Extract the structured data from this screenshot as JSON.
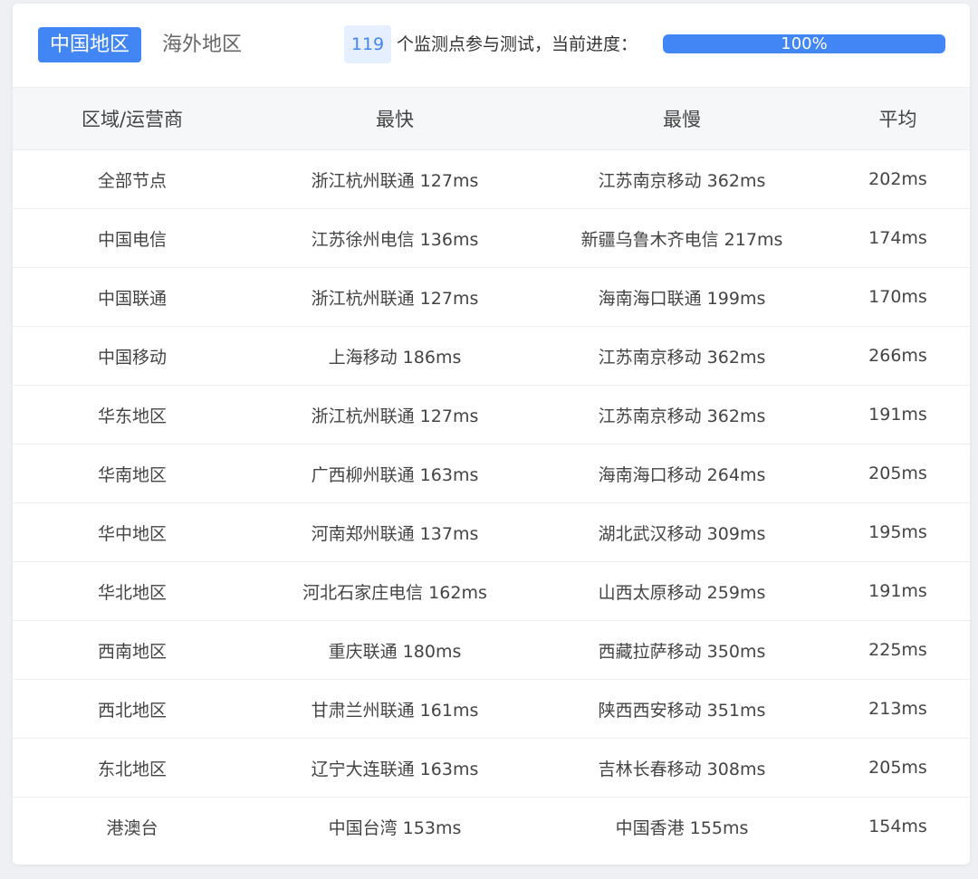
{
  "tabs": {
    "active": "中国地区",
    "inactive": "海外地区"
  },
  "progress": {
    "count": "119",
    "text": "个监测点参与测试，当前进度：",
    "percent_label": "100%",
    "percent_value": 100
  },
  "colors": {
    "accent": "#4285f4",
    "badge_bg": "#e6efff",
    "header_bg": "#f6f7f9"
  },
  "table": {
    "headers": [
      "区域/运营商",
      "最快",
      "最慢",
      "平均"
    ],
    "rows": [
      [
        "全部节点",
        "浙江杭州联通 127ms",
        "江苏南京移动 362ms",
        "202ms"
      ],
      [
        "中国电信",
        "江苏徐州电信 136ms",
        "新疆乌鲁木齐电信 217ms",
        "174ms"
      ],
      [
        "中国联通",
        "浙江杭州联通 127ms",
        "海南海口联通 199ms",
        "170ms"
      ],
      [
        "中国移动",
        "上海移动 186ms",
        "江苏南京移动 362ms",
        "266ms"
      ],
      [
        "华东地区",
        "浙江杭州联通 127ms",
        "江苏南京移动 362ms",
        "191ms"
      ],
      [
        "华南地区",
        "广西柳州联通 163ms",
        "海南海口移动 264ms",
        "205ms"
      ],
      [
        "华中地区",
        "河南郑州联通 137ms",
        "湖北武汉移动 309ms",
        "195ms"
      ],
      [
        "华北地区",
        "河北石家庄电信 162ms",
        "山西太原移动 259ms",
        "191ms"
      ],
      [
        "西南地区",
        "重庆联通 180ms",
        "西藏拉萨移动 350ms",
        "225ms"
      ],
      [
        "西北地区",
        "甘肃兰州联通 161ms",
        "陕西西安移动 351ms",
        "213ms"
      ],
      [
        "东北地区",
        "辽宁大连联通 163ms",
        "吉林长春移动 308ms",
        "205ms"
      ],
      [
        "港澳台",
        "中国台湾 153ms",
        "中国香港 155ms",
        "154ms"
      ]
    ]
  }
}
